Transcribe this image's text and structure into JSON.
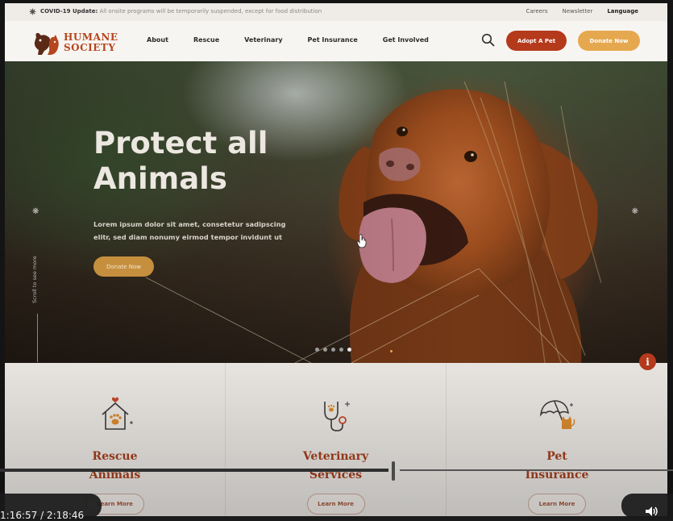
{
  "topbar": {
    "notice_label": "COVID-19 Update:",
    "notice_text": "All onsite programs will be temporarily suspended, except for food distribution",
    "links": [
      "Careers",
      "Newsletter",
      "Language"
    ]
  },
  "nav": {
    "logo_line1": "HUMANE",
    "logo_line2": "SOCIETY",
    "menu": [
      "About",
      "Rescue",
      "Veterinary",
      "Pet Insurance",
      "Get Involved"
    ],
    "adopt_label": "Adopt A Pet",
    "donate_label": "Donate Now"
  },
  "hero": {
    "title_line1": "Protect all",
    "title_line2": "Animals",
    "text": "Lorem ipsum dolor sit amet, consetetur sadipscing elitr, sed diam nonumy eirmod tempor invidunt ut",
    "donate_label": "Donate Now",
    "scroll_label": "Scroll to see more",
    "slide_count": 5,
    "active_slide": 1
  },
  "services": [
    {
      "title_line1": "Rescue",
      "title_line2": "Animals",
      "icon": "house-paw-icon",
      "button": "Learn More"
    },
    {
      "title_line1": "Veterinary",
      "title_line2": "Services",
      "icon": "stethoscope-icon",
      "button": "Learn More"
    },
    {
      "title_line1": "Pet",
      "title_line2": "Insurance",
      "icon": "umbrella-cat-icon",
      "button": "Learn More"
    }
  ],
  "player": {
    "time": "1:16:57 / 2:18:46"
  },
  "colors": {
    "brand": "#b5461e",
    "accent": "#e6a84e",
    "adopt": "#b53a1c"
  }
}
